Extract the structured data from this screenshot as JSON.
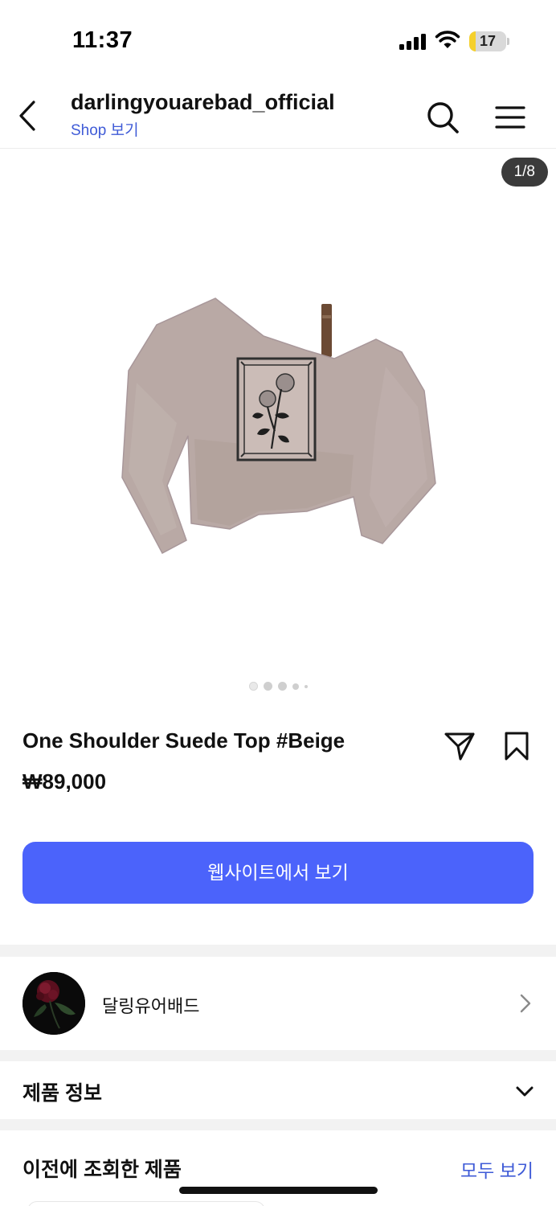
{
  "status_bar": {
    "time": "11:37",
    "battery_level": "17",
    "battery_fraction": 0.17
  },
  "header": {
    "title": "darlingyouarebad_official",
    "subtitle": "Shop 보기",
    "back_icon": "chevron-left-icon",
    "search_icon": "search-icon",
    "menu_icon": "hamburger-menu-icon"
  },
  "carousel": {
    "counter": "1/8",
    "image_count": 8,
    "current_index": 1
  },
  "product": {
    "title": "One Shoulder Suede Top #Beige",
    "price": "₩89,000",
    "share_icon": "share-icon",
    "save_icon": "bookmark-icon"
  },
  "cta": {
    "label": "웹사이트에서 보기",
    "color": "#4b63fb"
  },
  "shop": {
    "name": "달링유어배드",
    "chevron_icon": "chevron-right-icon"
  },
  "sections": {
    "product_info": "제품 정보",
    "recently_viewed": "이전에 조회한 제품",
    "see_all": "모두 보기"
  },
  "colors": {
    "link": "#3f5bd7",
    "primary_button": "#4b63fb",
    "separator": "#f2f2f2",
    "battery_low": "#f5d02c"
  }
}
